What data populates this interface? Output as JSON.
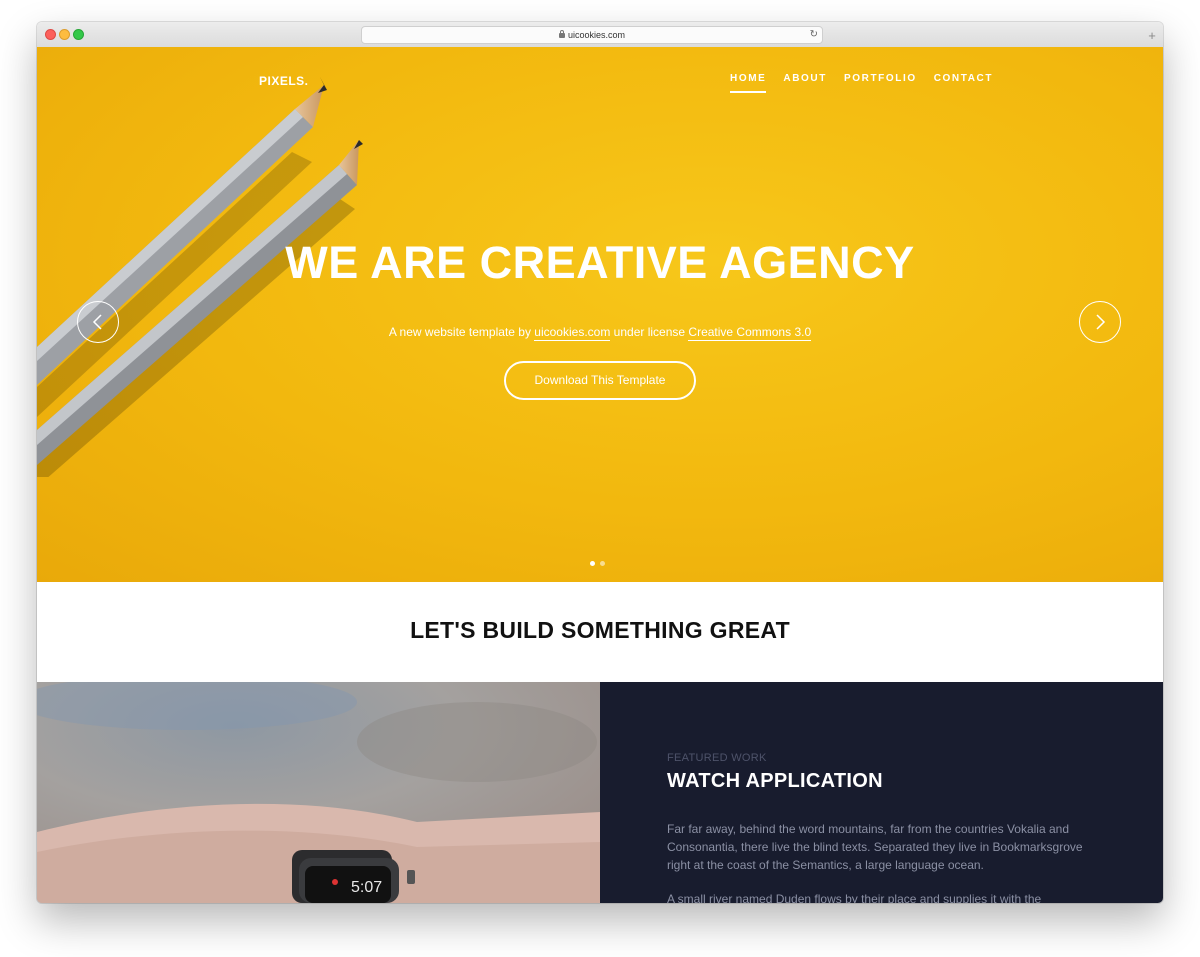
{
  "browser": {
    "url": "uicookies.com"
  },
  "hero": {
    "logo": "PIXELS.",
    "nav": [
      "HOME",
      "ABOUT",
      "PORTFOLIO",
      "CONTACT"
    ],
    "title": "WE ARE CREATIVE AGENCY",
    "subtitle_prefix": "A new website template by",
    "subtitle_link1": "uicookies.com",
    "subtitle_middle": "under license",
    "subtitle_link2": "Creative Commons 3.0",
    "cta": "Download This Template",
    "slide_count": 2,
    "active_slide": 1,
    "bg_color": "#f2b80e"
  },
  "intro": {
    "title": "LET'S BUILD SOMETHING GREAT"
  },
  "featured": {
    "kicker": "FEATURED WORK",
    "title": "WATCH APPLICATION",
    "para1": "Far far away, behind the word mountains, far from the countries Vokalia and Consonantia, there live the blind texts. Separated they live in Bookmarksgrove right at the coast of the Semantics, a large language ocean.",
    "para2": "A small river named Duden flows by their place and supplies it with the",
    "watch_time": "5:07",
    "panel_color": "#181c2e"
  }
}
